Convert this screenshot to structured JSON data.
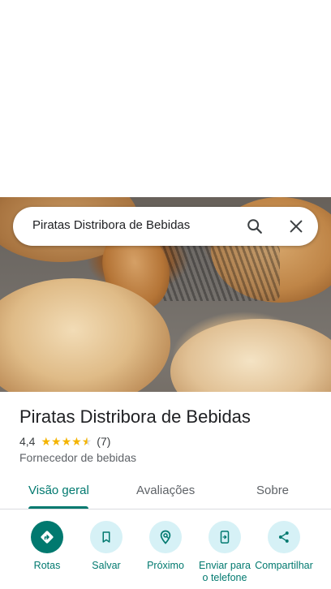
{
  "search": {
    "query": "Piratas Distribora de Bebidas",
    "icons": [
      "search-icon",
      "close-icon"
    ]
  },
  "photo": {
    "description_icon": "place-photo"
  },
  "place": {
    "name": "Piratas Distribora de Bebidas",
    "rating": "4,4",
    "rating_value": 4.4,
    "review_count": "(7)",
    "category": "Fornecedor de bebidas"
  },
  "tabs": [
    {
      "label": "Visão geral",
      "active": true
    },
    {
      "label": "Avaliações",
      "active": false
    },
    {
      "label": "Sobre",
      "active": false
    }
  ],
  "actions": [
    {
      "label": "Rotas",
      "icon": "directions-icon"
    },
    {
      "label": "Salvar",
      "icon": "bookmark-icon"
    },
    {
      "label": "Próximo",
      "icon": "nearby-icon"
    },
    {
      "label": "Enviar para o telefone",
      "icon": "send-to-phone-icon"
    },
    {
      "label": "Compartilhar",
      "icon": "share-icon"
    }
  ],
  "colors": {
    "accent": "#01796f",
    "action_bg": "#d6f1f6",
    "star": "#f4b400"
  }
}
